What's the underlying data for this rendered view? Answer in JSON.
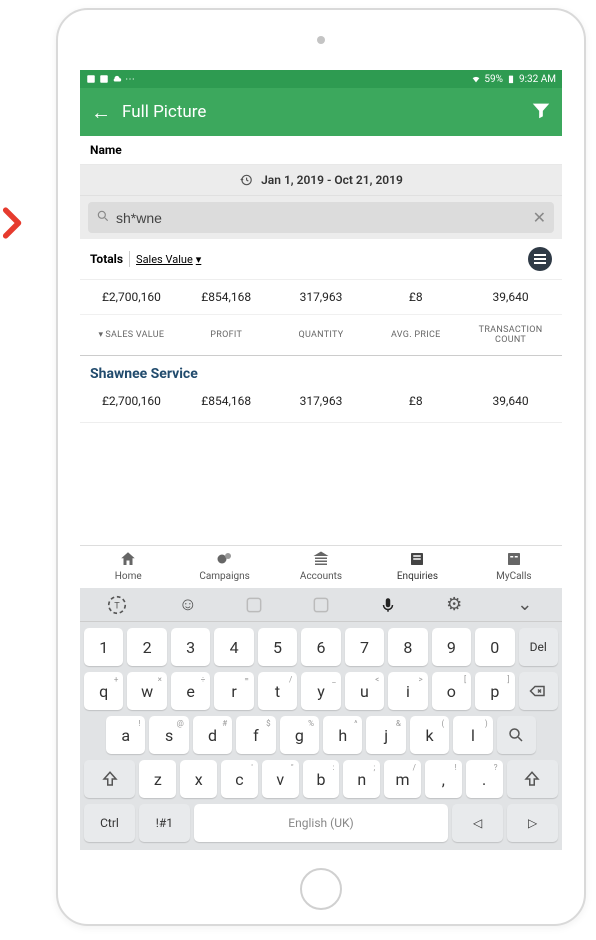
{
  "status_bar": {
    "battery_pct": "59%",
    "time": "9:32 AM"
  },
  "app_bar": {
    "title": "Full Picture"
  },
  "name_label": "Name",
  "date_range": "Jan 1, 2019 - Oct 21, 2019",
  "search": {
    "value": "sh*wne",
    "placeholder": ""
  },
  "totals": {
    "label": "Totals",
    "dropdown": "Sales Value",
    "values": {
      "sales_value": "£2,700,160",
      "profit": "£854,168",
      "quantity": "317,963",
      "avg_price": "£8",
      "transactions": "39,640"
    }
  },
  "columns": {
    "c1": "SALES VALUE",
    "c2": "PROFIT",
    "c3": "QUANTITY",
    "c4": "AVG. PRICE",
    "c5": "TRANSACTION COUNT"
  },
  "result": {
    "name": "Shawnee Service",
    "values": {
      "sales_value": "£2,700,160",
      "profit": "£854,168",
      "quantity": "317,963",
      "avg_price": "£8",
      "transactions": "39,640"
    }
  },
  "bottom_nav": {
    "home": "Home",
    "campaigns": "Campaigns",
    "accounts": "Accounts",
    "enquiries": "Enquiries",
    "mycalls": "MyCalls"
  },
  "keyboard": {
    "row_num": [
      "1",
      "2",
      "3",
      "4",
      "5",
      "6",
      "7",
      "8",
      "9",
      "0",
      "Del"
    ],
    "row_q": [
      {
        "k": "q",
        "s": "+"
      },
      {
        "k": "w",
        "s": "×"
      },
      {
        "k": "e",
        "s": "÷"
      },
      {
        "k": "r",
        "s": "="
      },
      {
        "k": "t",
        "s": "/"
      },
      {
        "k": "y",
        "s": "_"
      },
      {
        "k": "u",
        "s": "<"
      },
      {
        "k": "i",
        "s": ">"
      },
      {
        "k": "o",
        "s": "["
      },
      {
        "k": "p",
        "s": "]"
      }
    ],
    "row_a": [
      {
        "k": "a",
        "s": "!"
      },
      {
        "k": "s",
        "s": "@"
      },
      {
        "k": "d",
        "s": "#"
      },
      {
        "k": "f",
        "s": "$"
      },
      {
        "k": "g",
        "s": "%"
      },
      {
        "k": "h",
        "s": "^"
      },
      {
        "k": "j",
        "s": "&"
      },
      {
        "k": "k",
        "s": "("
      },
      {
        "k": "l",
        "s": ")"
      }
    ],
    "row_z": [
      {
        "k": "z",
        "s": ""
      },
      {
        "k": "x",
        "s": ""
      },
      {
        "k": "c",
        "s": "'"
      },
      {
        "k": "v",
        "s": "\""
      },
      {
        "k": "b",
        "s": ":"
      },
      {
        "k": "n",
        "s": ";"
      },
      {
        "k": "m",
        "s": "/"
      }
    ],
    "comma_key": {
      "k": ",",
      "s": "!"
    },
    "period_key": {
      "k": ".",
      "s": "?"
    },
    "ctrl": "Ctrl",
    "sym": "!#1",
    "space_label": "English (UK)"
  }
}
